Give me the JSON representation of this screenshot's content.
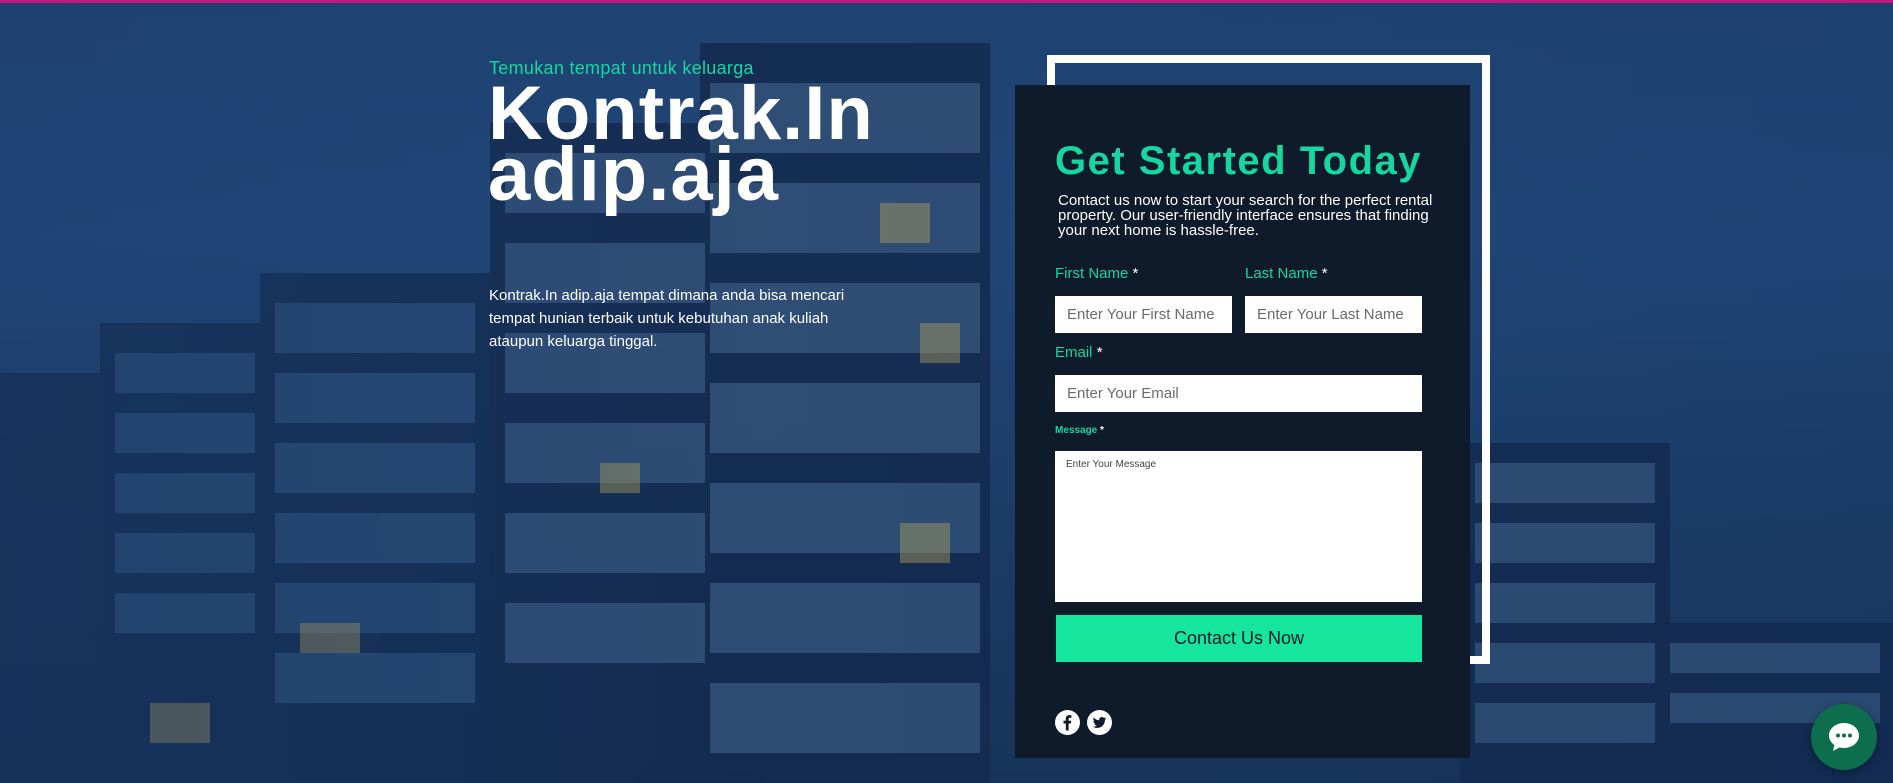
{
  "hero": {
    "tagline": "Temukan tempat untuk keluarga",
    "title_line1": "Kontrak.In",
    "title_line2": "adip.aja",
    "description": "Kontrak.In adip.aja tempat dimana anda bisa mencari tempat hunian terbaik untuk kebutuhan anak kuliah ataupun keluarga tinggal."
  },
  "form": {
    "heading": "Get Started Today",
    "intro": "Contact us now to start your search for the perfect rental property. Our user-friendly interface ensures that finding your next home is hassle-free.",
    "required_mark": "*",
    "first_name": {
      "label": "First Name",
      "placeholder": "Enter Your First Name"
    },
    "last_name": {
      "label": "Last Name",
      "placeholder": "Enter Your Last Name"
    },
    "email": {
      "label": "Email",
      "placeholder": "Enter Your Email"
    },
    "message": {
      "label": "Message",
      "placeholder": "Enter Your Message"
    },
    "submit_label": "Contact Us Now"
  },
  "social": {
    "icons": [
      "facebook-icon",
      "twitter-icon"
    ]
  },
  "chat": {
    "icon": "chat-bubble-icon"
  },
  "colors": {
    "accent": "#16d7a0",
    "button": "#16e69d",
    "panel": "#0f1a2a",
    "top_strip": "#c2187f",
    "chat_button": "#0d6e4e"
  }
}
